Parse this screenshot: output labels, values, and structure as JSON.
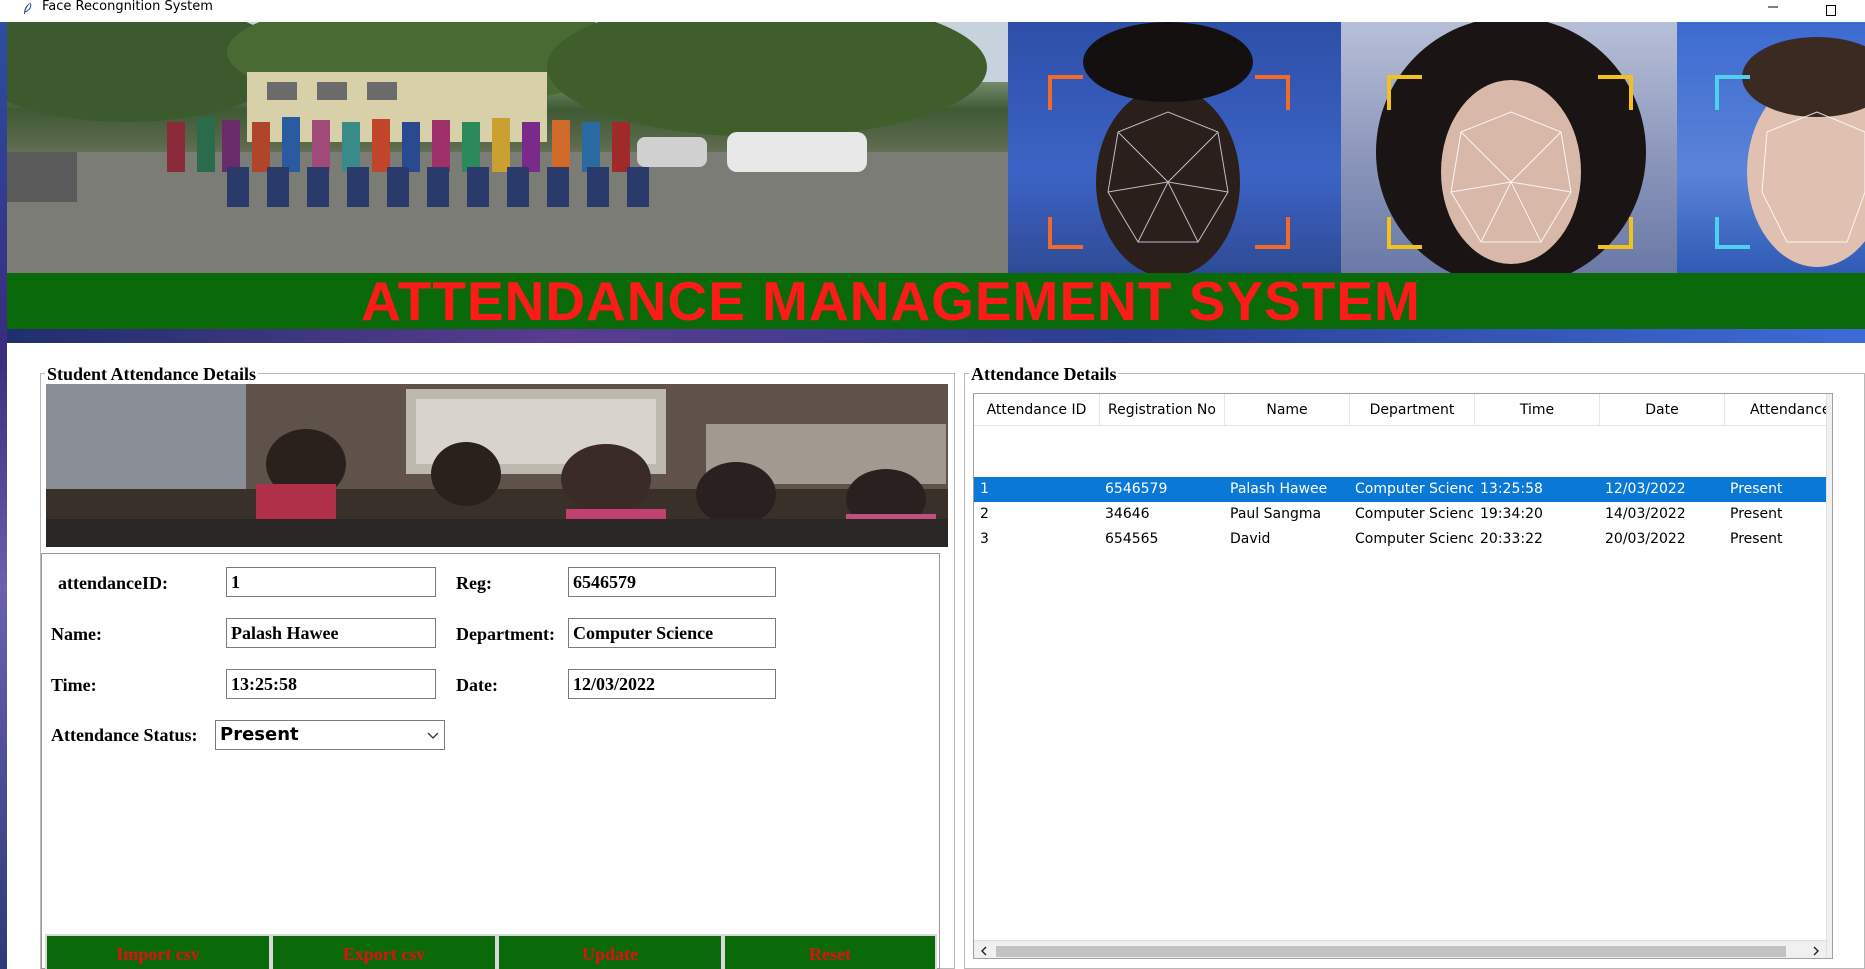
{
  "window": {
    "title": "Face Recongnition System",
    "icon": "feather-icon",
    "controls": [
      "minimize-icon",
      "maximize-icon"
    ]
  },
  "banner": {
    "headline": "ATTENDANCE MANAGEMENT SYSTEM",
    "colors": {
      "strip": "#0a6a0a",
      "text": "#ff1a1a"
    }
  },
  "left_panel": {
    "title": "Student Attendance Details",
    "form": {
      "attendance_id_label": "attendanceID:",
      "attendance_id_value": "1",
      "reg_label": "Reg:",
      "reg_value": "6546579",
      "name_label": "Name:",
      "name_value": "Palash Hawee",
      "department_label": "Department:",
      "department_value": "Computer Science",
      "time_label": "Time:",
      "time_value": "13:25:58",
      "date_label": "Date:",
      "date_value": "12/03/2022",
      "status_label": "Attendance Status:",
      "status_value": "Present"
    },
    "buttons": {
      "import": "Import csv",
      "export": "Export csv",
      "update": "Update",
      "reset": "Reset"
    }
  },
  "right_panel": {
    "title": "Attendance Details",
    "columns": [
      "Attendance ID",
      "Registration No",
      "Name",
      "Department",
      "Time",
      "Date",
      "Attendance"
    ],
    "rows": [
      [
        "1",
        "6546579",
        "Palash Hawee",
        "Computer Scienc",
        "13:25:58",
        "12/03/2022",
        "Present"
      ],
      [
        "2",
        "34646",
        "Paul Sangma",
        "Computer Scienc",
        "19:34:20",
        "14/03/2022",
        "Present"
      ],
      [
        "3",
        "654565",
        "David",
        "Computer Scienc",
        "20:33:22",
        "20/03/2022",
        "Present"
      ]
    ],
    "selected_row": 0,
    "selection_color": "#0a78d7"
  }
}
